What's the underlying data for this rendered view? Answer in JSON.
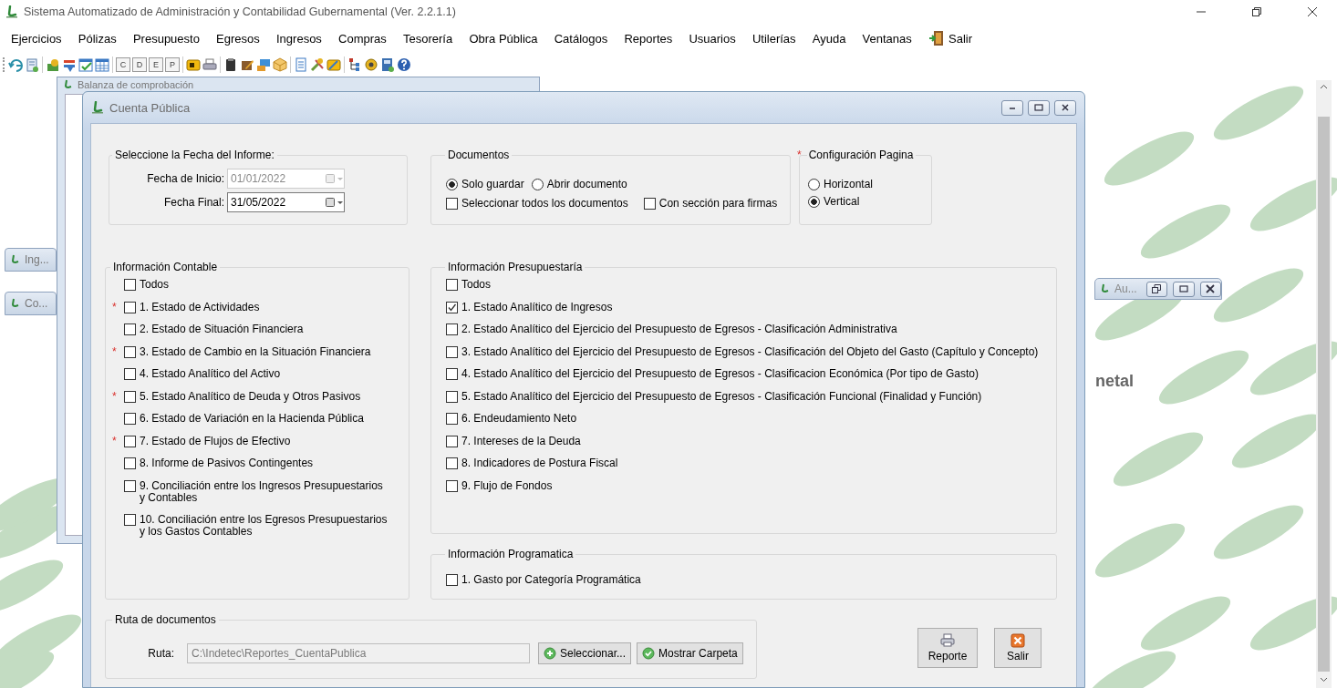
{
  "window": {
    "title": "Sistema Automatizado de Administración y Contabilidad Gubernamental (Ver. 2.2.1.1)"
  },
  "menu": {
    "items": [
      "Ejercicios",
      "Pólizas",
      "Presupuesto",
      "Egresos",
      "Ingresos",
      "Compras",
      "Tesorería",
      "Obra Pública",
      "Catálogos",
      "Reportes",
      "Usuarios",
      "Utilerías",
      "Ayuda",
      "Ventanas"
    ],
    "exit": "Salir"
  },
  "toolbar": {
    "letter_buttons": [
      "C",
      "D",
      "E",
      "P"
    ]
  },
  "desktop": {
    "background_windows": [
      {
        "title": "Balanza de comprobación"
      }
    ],
    "minimized_windows": [
      {
        "title": "Ing...",
        "kind": "tab"
      },
      {
        "title": "Co...",
        "kind": "tab"
      },
      {
        "title": "Au...",
        "kind": "bar"
      }
    ],
    "logo_text": "netal"
  },
  "dialog": {
    "title": "Cuenta Pública",
    "date_group": {
      "title": "Seleccione la Fecha del Informe:",
      "fields": [
        {
          "label": "Fecha de Inicio:",
          "value": "01/01/2022",
          "disabled": true
        },
        {
          "label": "Fecha Final:",
          "value": "31/05/2022",
          "disabled": false
        }
      ]
    },
    "documents": {
      "title": "Documentos",
      "options": [
        {
          "label": "Solo guardar",
          "kind": "radio",
          "selected": true
        },
        {
          "label": "Abrir documento",
          "kind": "radio",
          "selected": false
        },
        {
          "label": "Seleccionar todos los documentos",
          "kind": "checkbox",
          "checked": false
        },
        {
          "label": "Con sección para firmas",
          "kind": "checkbox",
          "checked": false
        }
      ]
    },
    "page_config": {
      "title": "Configuración Pagina",
      "marker": "*",
      "options": [
        {
          "label": "Horizontal",
          "selected": false
        },
        {
          "label": "Vertical",
          "selected": true
        }
      ]
    },
    "contable": {
      "title": "Información Contable",
      "items": [
        {
          "label": "Todos",
          "checked": false
        },
        {
          "label": "1. Estado de Actividades",
          "checked": false,
          "marker": "*"
        },
        {
          "label": "2. Estado de Situación Financiera",
          "checked": false
        },
        {
          "label": "3. Estado de Cambio en la Situación Financiera",
          "checked": false,
          "marker": "*"
        },
        {
          "label": "4. Estado Analítico del Activo",
          "checked": false
        },
        {
          "label": "5. Estado Analítico de Deuda y Otros Pasivos",
          "checked": false,
          "marker": "*"
        },
        {
          "label": "6. Estado de Variación en la Hacienda Pública",
          "checked": false
        },
        {
          "label": "7. Estado de Flujos de Efectivo",
          "checked": false,
          "marker": "*"
        },
        {
          "label": "8. Informe de Pasivos Contingentes",
          "checked": false
        },
        {
          "label": "9. Conciliación entre los Ingresos Presupuestarios y Contables",
          "checked": false
        },
        {
          "label": "10. Conciliación entre los Egresos Presupuestarios y los Gastos Contables",
          "checked": false
        }
      ]
    },
    "presupuestaria": {
      "title": "Información Presupuestaría",
      "items": [
        {
          "label": "Todos",
          "checked": false
        },
        {
          "label": "1. Estado Analítico de Ingresos",
          "checked": true
        },
        {
          "label": "2. Estado Analítico del Ejercicio del Presupuesto de Egresos - Clasificación Administrativa",
          "checked": false
        },
        {
          "label": "3. Estado Analítico del Ejercicio del Presupuesto de Egresos - Clasificación del Objeto del Gasto (Capítulo y Concepto)",
          "checked": false
        },
        {
          "label": "4. Estado Analítico del Ejercicio del Presupuesto de Egresos - Clasificacion Económica (Por tipo de Gasto)",
          "checked": false
        },
        {
          "label": "5. Estado Analítico del Ejercicio del Presupuesto de Egresos - Clasificación Funcional (Finalidad y Función)",
          "checked": false
        },
        {
          "label": "6. Endeudamiento Neto",
          "checked": false
        },
        {
          "label": "7. Intereses de la Deuda",
          "checked": false
        },
        {
          "label": "8. Indicadores de Postura Fiscal",
          "checked": false
        },
        {
          "label": "9. Flujo de Fondos",
          "checked": false
        }
      ]
    },
    "programatica": {
      "title": "Información Programatica",
      "items": [
        {
          "label": "1. Gasto por Categoría Programática",
          "checked": false
        }
      ]
    },
    "route": {
      "title": "Ruta de documentos",
      "label": "Ruta:",
      "value": "C:\\Indetec\\Reportes_CuentaPublica",
      "disabled": true,
      "buttons": [
        {
          "label": "Seleccionar...",
          "kind": "add"
        },
        {
          "label": "Mostrar Carpeta",
          "kind": "ok"
        }
      ]
    },
    "actions": [
      {
        "label": "Reporte",
        "kind": "print"
      },
      {
        "label": "Salir",
        "kind": "exit"
      }
    ]
  }
}
